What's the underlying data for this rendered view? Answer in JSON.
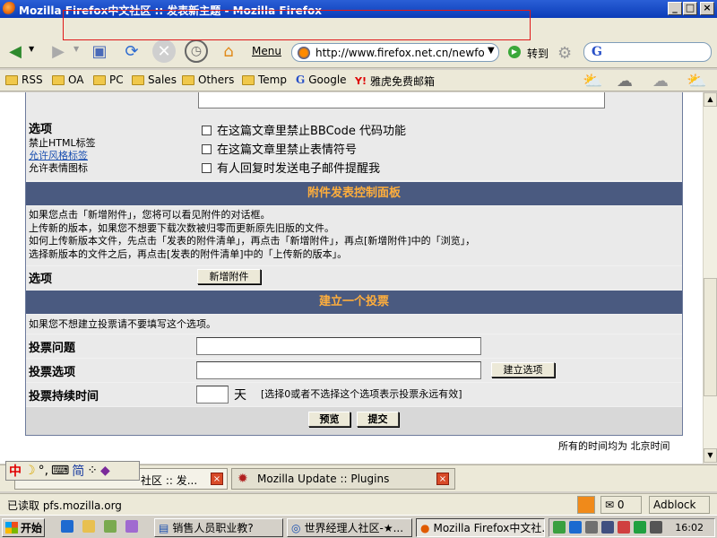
{
  "window": {
    "title": "Mozilla Firefox中文社区 :: 发表新主题 - Mozilla Firefox",
    "min": "_",
    "max": "□",
    "close": "×"
  },
  "toolbar": {
    "menu_label": "Menu",
    "url": "http://www.firefox.net.cn/newfo",
    "go_label": "转到",
    "search_logo": "G"
  },
  "bookmarks": [
    "RSS",
    "OA",
    "PC",
    "Sales",
    "Others",
    "Temp",
    "Google",
    "雅虎免费邮箱"
  ],
  "form": {
    "options_section": {
      "label": "选项",
      "links": [
        "禁止HTML标签",
        "允许风格标签",
        "允许表情图标"
      ],
      "checkboxes": [
        "在这篇文章里禁止BBCode 代码功能",
        "在这篇文章里禁止表情符号",
        "有人回复时发送电子邮件提醒我"
      ]
    },
    "attach_panel": {
      "title": "附件发表控制面板",
      "notes": [
        "如果您点击「新增附件」，您将可以看见附件的对话框。",
        "上传新的版本，如果您不想要下载次数被归零而更新原先旧版的文件。",
        "如何上传新版本文件，先点击「发表的附件清单」，再点击「新增附件」，再点[新增附件]中的「浏览」，",
        "选择新版本的文件之后，再点击[发表的附件清单]中的「上传新的版本」。"
      ],
      "options_label": "选项",
      "add_attachment_button": "新增附件"
    },
    "poll": {
      "title": "建立一个投票",
      "note": "如果您不想建立投票请不要填写这个选项。",
      "question_label": "投票问题",
      "option_label": "投票选项",
      "add_option_button": "建立选项",
      "duration_label": "投票持续时间",
      "days_unit": "天",
      "duration_hint": "[选择0或者不选择这个选项表示投票永远有效]"
    },
    "preview_button": "预览",
    "submit_button": "提交",
    "timezone_note": "所有的时间均为 北京时间"
  },
  "tabs": [
    {
      "label": "社区 :: 发..."
    },
    {
      "label": "Mozilla Update :: Plugins"
    }
  ],
  "ime": {
    "zh": "中",
    "mode": "简"
  },
  "status": {
    "text": "已读取 pfs.mozilla.org",
    "mail_count": "0",
    "adblock": "Adblock"
  },
  "taskbar": {
    "start": "开始",
    "buttons": [
      "销售人员职业教?",
      "世界经理人社区-★...",
      "Mozilla Firefox中文社..."
    ],
    "clock": "16:02"
  }
}
